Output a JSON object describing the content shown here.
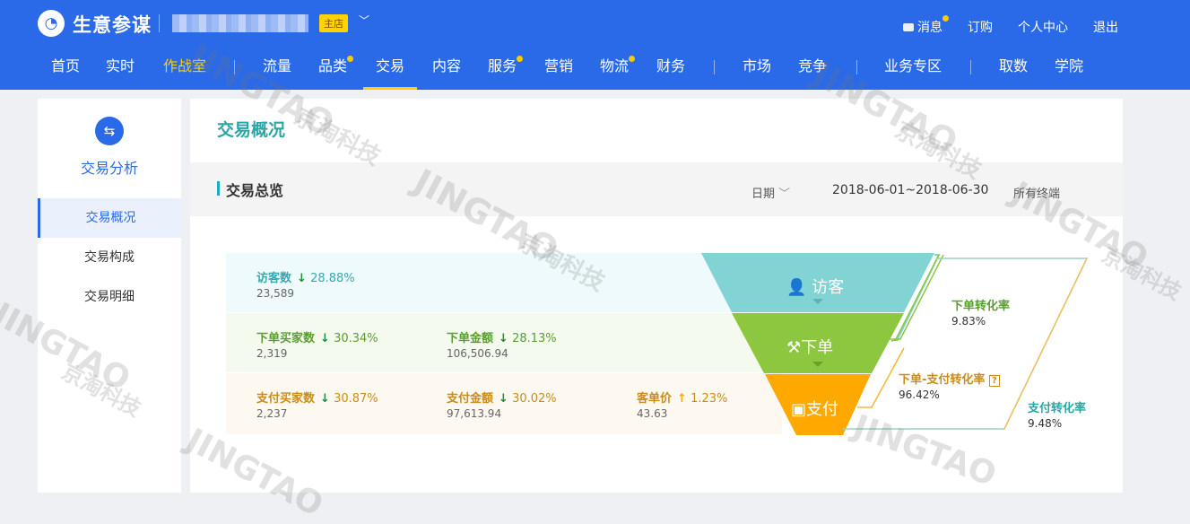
{
  "header": {
    "logo_text": "生意参谋",
    "main_badge": "主店",
    "right_links": [
      "消息",
      "订购",
      "个人中心",
      "退出"
    ]
  },
  "nav": {
    "items": [
      "首页",
      "实时",
      "作战室",
      "流量",
      "品类",
      "交易",
      "内容",
      "服务",
      "营销",
      "物流",
      "财务",
      "市场",
      "竞争",
      "业务专区",
      "取数",
      "学院"
    ],
    "active": "交易",
    "highlighted": "作战室"
  },
  "sidebar": {
    "title": "交易分析",
    "items": [
      "交易概况",
      "交易构成",
      "交易明细"
    ],
    "active": "交易概况"
  },
  "page": {
    "title": "交易概况",
    "section_title": "交易总览",
    "date_label": "日期",
    "date_range": "2018-06-01~2018-06-30",
    "terminal": "所有终端"
  },
  "metrics": {
    "visitors": {
      "label": "访客数",
      "trend": "down",
      "pct": "28.88%",
      "value": "23,589"
    },
    "order_buyers": {
      "label": "下单买家数",
      "trend": "down",
      "pct": "30.34%",
      "value": "2,319"
    },
    "order_amount": {
      "label": "下单金额",
      "trend": "down",
      "pct": "28.13%",
      "value": "106,506.94"
    },
    "pay_buyers": {
      "label": "支付买家数",
      "trend": "down",
      "pct": "30.87%",
      "value": "2,237"
    },
    "pay_amount": {
      "label": "支付金额",
      "trend": "down",
      "pct": "30.02%",
      "value": "97,613.94"
    },
    "unit_price": {
      "label": "客单价",
      "trend": "up",
      "pct": "1.23%",
      "value": "43.63"
    }
  },
  "funnel": {
    "stages": [
      "访客",
      "下单",
      "支付"
    ],
    "order_conv": {
      "label": "下单转化率",
      "value": "9.83%"
    },
    "order_pay_conv": {
      "label": "下单-支付转化率",
      "value": "96.42%"
    },
    "pay_conv": {
      "label": "支付转化率",
      "value": "9.48%"
    }
  },
  "colors": {
    "blue": "#2a6ae9",
    "teal": "#82d3d3",
    "green": "#8dc63f",
    "orange": "#ffa800",
    "yellow": "#ffd200"
  },
  "watermarks": [
    "JINGTAO",
    "京淘科技"
  ]
}
